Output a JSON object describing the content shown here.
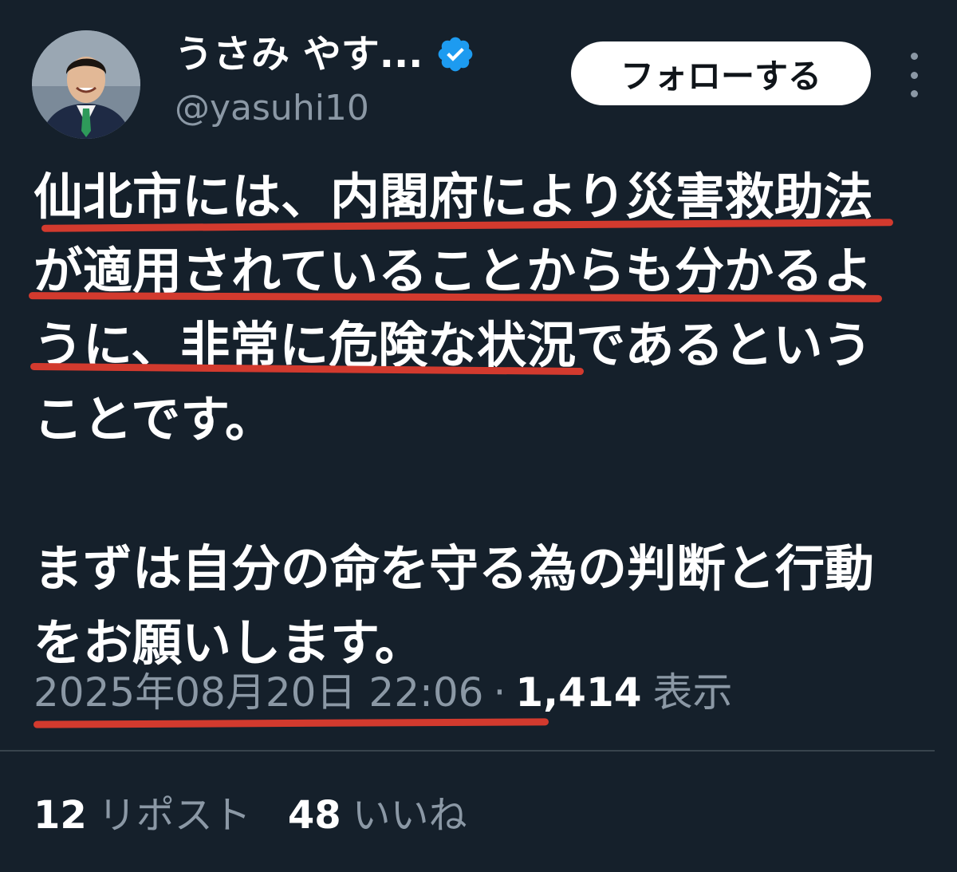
{
  "author": {
    "display_name": "うさみ やす...",
    "handle": "@yasuhi10",
    "verified_icon": "verified-badge-icon",
    "verified_color": "#1d9bf0"
  },
  "follow_button": {
    "label": "フォローする"
  },
  "more_menu_icon": "more-vertical-icon",
  "tweet": {
    "lines": [
      "仙北市には、内閣府により災害救助法",
      "が適用されていることからも分かるよ",
      "うに、非常に危険な状況であるという",
      "ことです。",
      "",
      "まずは自分の命を守る為の判断と行動",
      "をお願いします。"
    ]
  },
  "meta": {
    "timestamp": "2025年08月20日 22:06",
    "separator": "·",
    "views_count": "1,414",
    "views_label": "表示"
  },
  "stats": {
    "reposts_count": "12",
    "reposts_label": "リポスト",
    "likes_count": "48",
    "likes_label": "いいね"
  },
  "colors": {
    "background": "#15202b",
    "text_primary": "#ffffff",
    "text_secondary": "#8b98a5",
    "highlight_underline": "#d23a2e",
    "follow_bg": "#ffffff"
  }
}
